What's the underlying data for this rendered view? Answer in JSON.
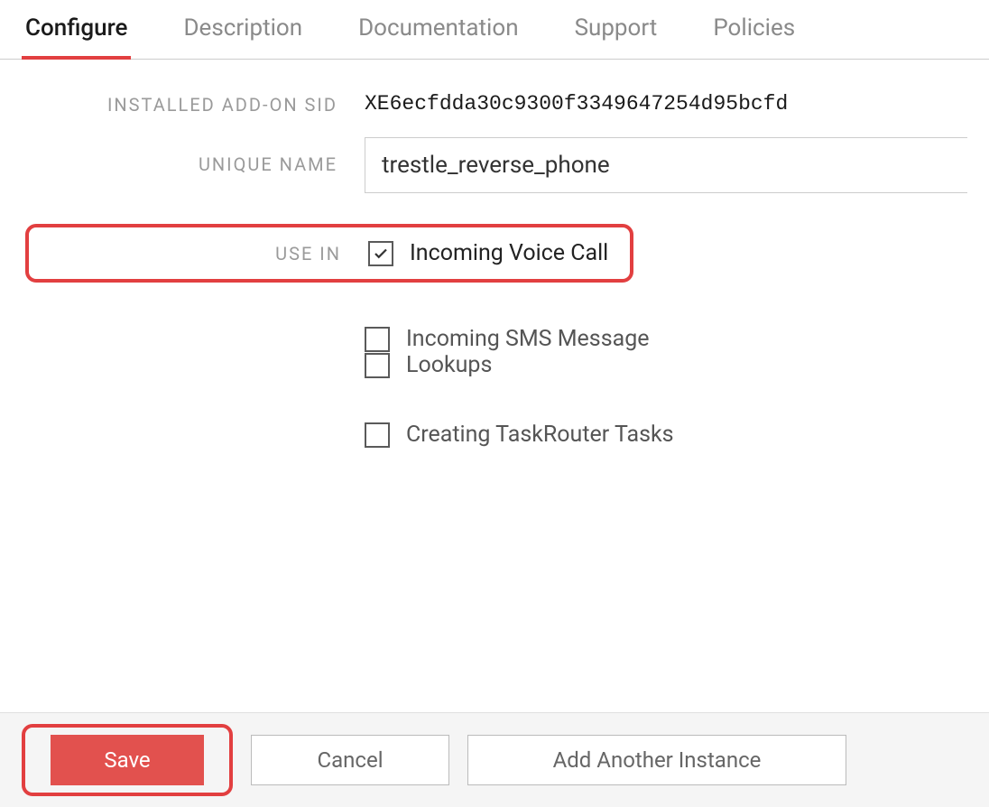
{
  "tabs": {
    "configure": "Configure",
    "description": "Description",
    "documentation": "Documentation",
    "support": "Support",
    "policies": "Policies"
  },
  "fields": {
    "sid_label": "INSTALLED ADD-ON SID",
    "sid_value": "XE6ecfdda30c9300f3349647254d95bcfd",
    "unique_name_label": "UNIQUE NAME",
    "unique_name_value": "trestle_reverse_phone",
    "use_in_label": "USE IN"
  },
  "use_in": {
    "voice": {
      "label": "Incoming Voice Call",
      "checked": true
    },
    "sms": {
      "label": "Incoming SMS Message",
      "checked": false
    },
    "lookups": {
      "label": "Lookups",
      "checked": false
    },
    "taskrouter": {
      "label": "Creating TaskRouter Tasks",
      "checked": false
    }
  },
  "actions": {
    "save": "Save",
    "cancel": "Cancel",
    "add_another": "Add Another Instance"
  }
}
